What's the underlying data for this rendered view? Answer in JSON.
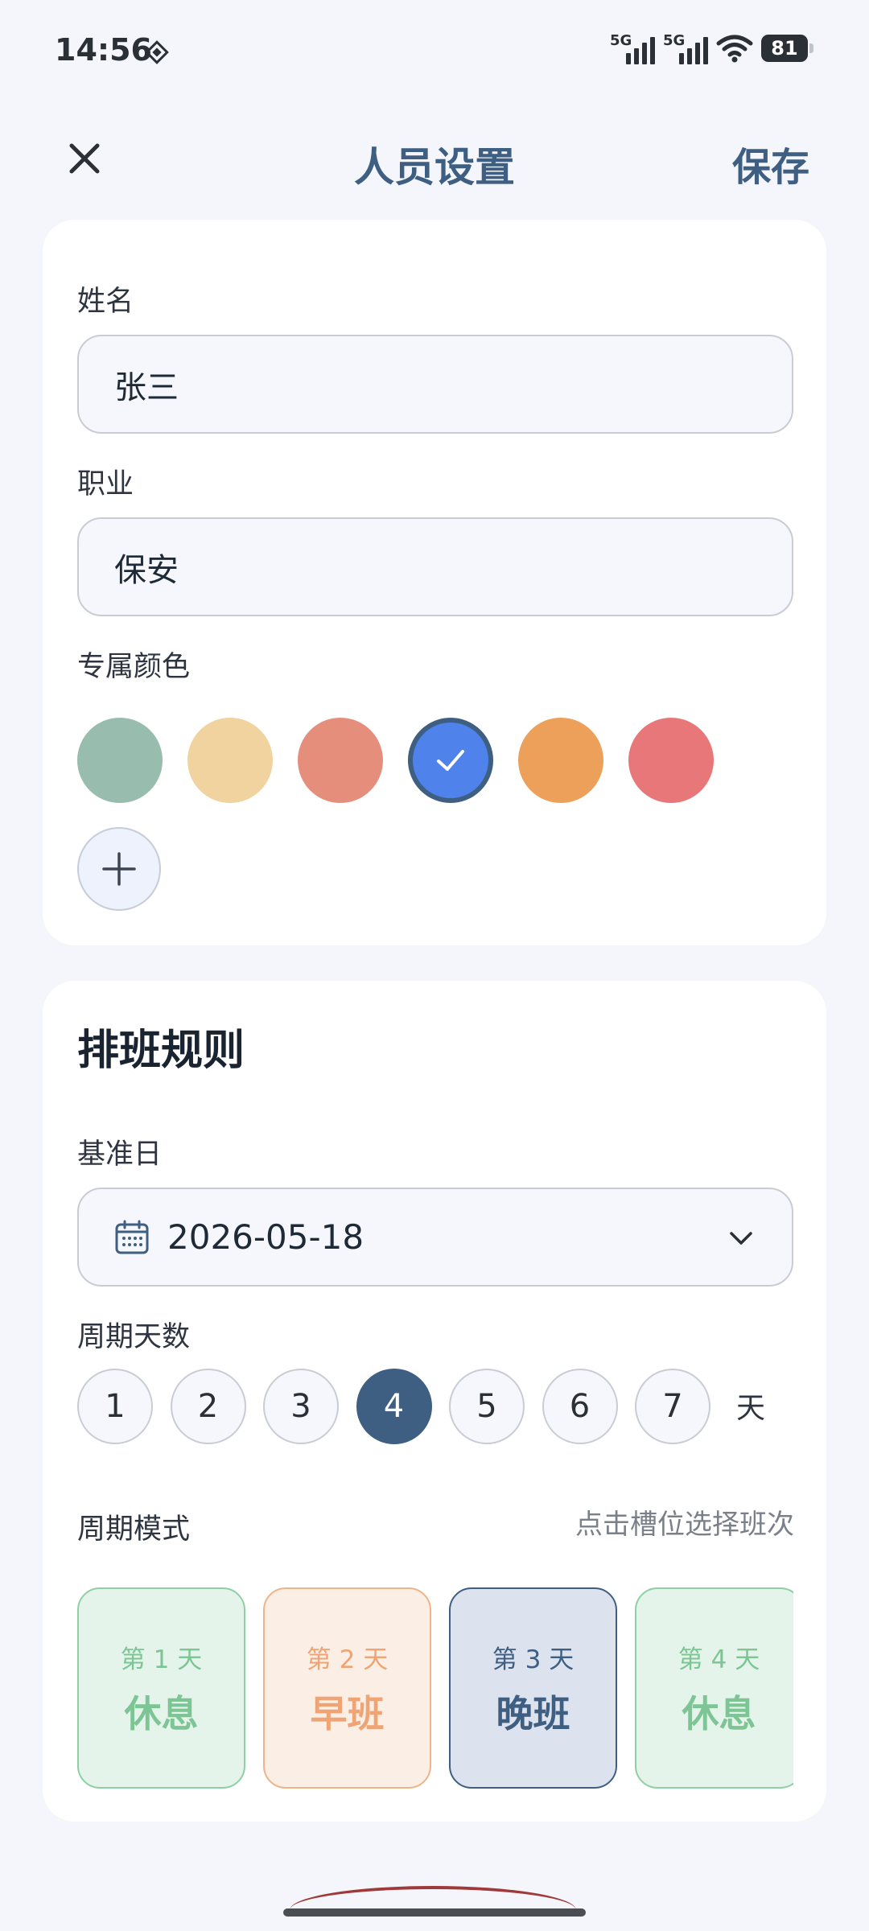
{
  "status_bar": {
    "time": "14:56",
    "signal1_label": "5G",
    "signal2_label": "5G",
    "battery": "81"
  },
  "app_bar": {
    "title": "人员设置",
    "save_label": "保存",
    "close_icon": "close-icon"
  },
  "profile": {
    "name_label": "姓名",
    "name_value": "张三",
    "job_label": "职业",
    "job_value": "保安",
    "color_label": "专属颜色",
    "colors": [
      "#98bcad",
      "#f0d39e",
      "#e58e7c",
      "#4f82ea",
      "#eda059",
      "#e77778"
    ],
    "selected_color_index": 3
  },
  "rules": {
    "title": "排班规则",
    "base_date_label": "基准日",
    "base_date_value": "2026-05-18",
    "cycle_days_label": "周期天数",
    "cycle_options": [
      "1",
      "2",
      "3",
      "4",
      "5",
      "6",
      "7"
    ],
    "cycle_selected": "4",
    "cycle_unit": "天",
    "pattern_label": "周期模式",
    "pattern_hint": "点击槽位选择班次",
    "slots": [
      {
        "day": "第 1 天",
        "shift": "休息",
        "color": "#7dc594"
      },
      {
        "day": "第 2 天",
        "shift": "早班",
        "color": "#eea474"
      },
      {
        "day": "第 3 天",
        "shift": "晚班",
        "color": "#3e5f82"
      },
      {
        "day": "第 4 天",
        "shift": "休息",
        "color": "#7dc594"
      }
    ]
  }
}
